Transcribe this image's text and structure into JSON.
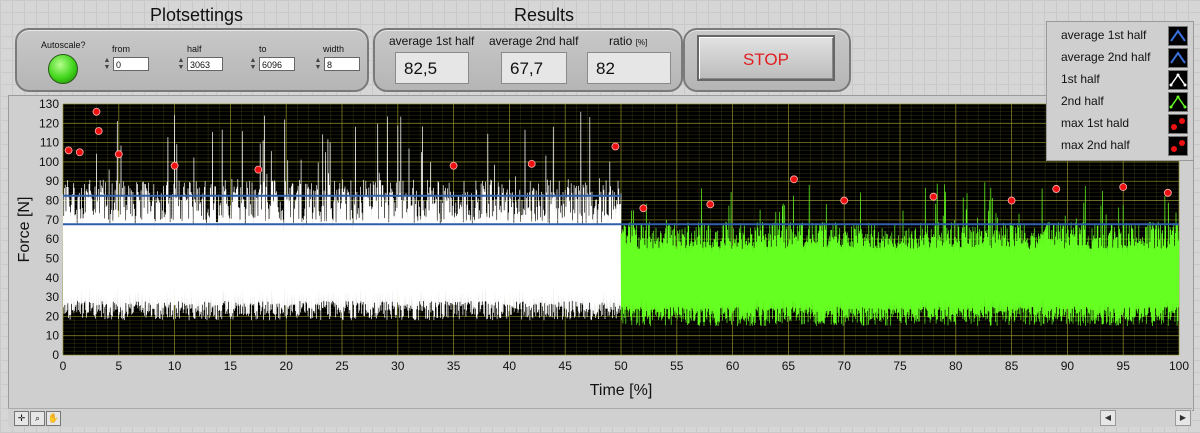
{
  "plotsettings": {
    "title": "Plotsettings",
    "autoscale_label": "Autoscale?",
    "fields": [
      {
        "label": "from",
        "value": "0"
      },
      {
        "label": "half",
        "value": "3063"
      },
      {
        "label": "to",
        "value": "6096"
      },
      {
        "label": "width",
        "value": "8"
      }
    ]
  },
  "results": {
    "title": "Results",
    "avg1_label": "average 1st half",
    "avg1_value": "82,5",
    "avg2_label": "average 2nd half",
    "avg2_value": "67,7",
    "ratio_label": "ratio",
    "ratio_unit": "[%]",
    "ratio_value": "82"
  },
  "stop_label": "STOP",
  "legend": [
    {
      "label": "average 1st half",
      "icon": "line-blue-icon"
    },
    {
      "label": "average 2nd half",
      "icon": "line-blue-icon"
    },
    {
      "label": "1st half",
      "icon": "line-white-icon"
    },
    {
      "label": "2nd half",
      "icon": "line-green-icon"
    },
    {
      "label": "max 1st hald",
      "icon": "points-red-icon"
    },
    {
      "label": "max 2nd half",
      "icon": "points-red-icon"
    }
  ],
  "colors": {
    "plot_bg": "#000000",
    "grid": "#8c8c2a",
    "first_half": "#ffffff",
    "second_half": "#66ff22",
    "average_line": "#2f5fa8",
    "max_marker": "#ee1111",
    "led_on": "#3fd41a"
  },
  "chart_data": {
    "type": "line",
    "xlabel": "Time [%]",
    "ylabel": "Force [N]",
    "xlim": [
      0,
      100
    ],
    "ylim": [
      0,
      130
    ],
    "x_ticks": [
      "0",
      "5",
      "10",
      "15",
      "20",
      "25",
      "30",
      "35",
      "40",
      "45",
      "50",
      "55",
      "60",
      "65",
      "70",
      "75",
      "80",
      "85",
      "90",
      "95",
      "100"
    ],
    "y_ticks": [
      "0",
      "10",
      "20",
      "30",
      "40",
      "50",
      "60",
      "70",
      "80",
      "90",
      "100",
      "110",
      "120",
      "130"
    ],
    "grid": true,
    "series": [
      {
        "name": "average 1st half",
        "x": [
          0,
          50
        ],
        "y": [
          82.5,
          82.5
        ]
      },
      {
        "name": "average 2nd half",
        "x": [
          0,
          100
        ],
        "y": [
          67.7,
          67.7
        ]
      },
      {
        "name": "1st half",
        "x_range": [
          0,
          50
        ],
        "y_min_range": [
          18,
          28
        ],
        "y_max_range": [
          68,
          126
        ]
      },
      {
        "name": "2nd half",
        "x_range": [
          50,
          100
        ],
        "y_min_range": [
          15,
          25
        ],
        "y_max_range": [
          55,
          90
        ]
      },
      {
        "name": "max 1st hald",
        "x": [
          0.5,
          1.5,
          3,
          3.2,
          5,
          10,
          17.5,
          35,
          42,
          49.5
        ],
        "y": [
          106,
          105,
          126,
          116,
          104,
          98,
          96,
          98,
          99,
          108
        ]
      },
      {
        "name": "max 2nd half",
        "x": [
          52,
          58,
          65.5,
          70,
          78,
          85,
          89,
          95,
          99
        ],
        "y": [
          76,
          78,
          91,
          80,
          82,
          80,
          86,
          87,
          84
        ]
      }
    ]
  }
}
